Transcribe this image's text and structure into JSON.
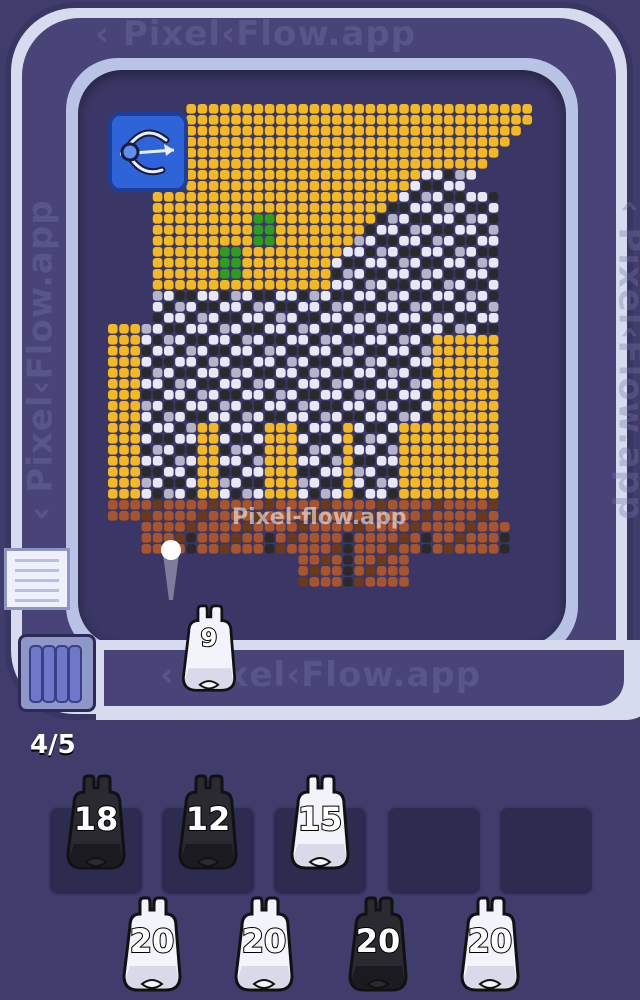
{
  "app": {
    "watermark": "Pixel-Flow.app",
    "watermark_short": "Pixel-flow.app",
    "watermark_arrow": "‹ Pixel‹Flow.app"
  },
  "queue": {
    "progress": "4/5"
  },
  "shooter": {
    "count": "9",
    "color": "white"
  },
  "slots": [
    {
      "count": "18",
      "color": "black"
    },
    {
      "count": "12",
      "color": "black"
    },
    {
      "count": "15",
      "color": "white"
    },
    {
      "count": "",
      "color": "empty"
    },
    {
      "count": "",
      "color": "empty"
    }
  ],
  "waiting": [
    {
      "count": "20",
      "color": "white"
    },
    {
      "count": "20",
      "color": "white"
    },
    {
      "count": "20",
      "color": "black"
    },
    {
      "count": "20",
      "color": "white"
    }
  ],
  "powerup": {
    "icon": "bow-arrow-icon"
  },
  "palette": {
    "yellow": "#f4b820",
    "white": "#e8e8f4",
    "grey": "#b4b4c8",
    "black": "#2a2a2c",
    "brown": "#a8552e",
    "green": "#2d9c20",
    "darkbrown": "#6b3a1a"
  }
}
